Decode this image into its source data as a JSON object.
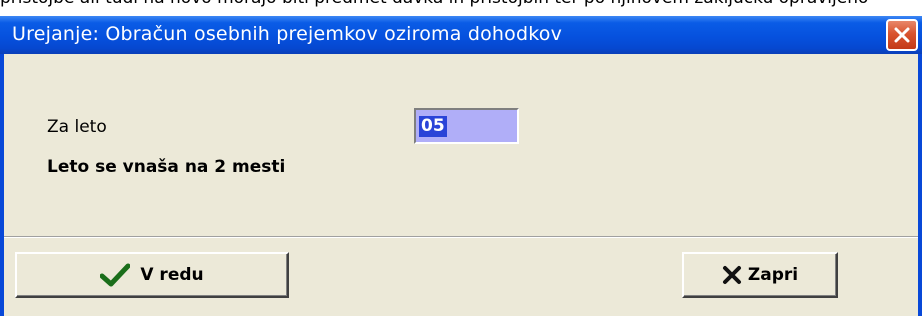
{
  "background": {
    "partial_text": "pristojbe ali tudi na novo morajo biti predmet davka in pristojbin ter po njihovem zaključku opravljeno"
  },
  "window": {
    "title": "Urejanje: Obračun osebnih prejemkov oziroma dohodkov",
    "title_bar_color": "#0a5ce6"
  },
  "form": {
    "year_label": "Za leto",
    "year_value": "05",
    "hint": "Leto se vnaša na 2 mesti",
    "input_color": "#b0aef8",
    "selection_color": "#2a44d8"
  },
  "buttons": {
    "ok_label": "V redu",
    "ok_icon": "checkmark-icon",
    "close_label": "Zapri",
    "close_icon": "x-icon"
  }
}
